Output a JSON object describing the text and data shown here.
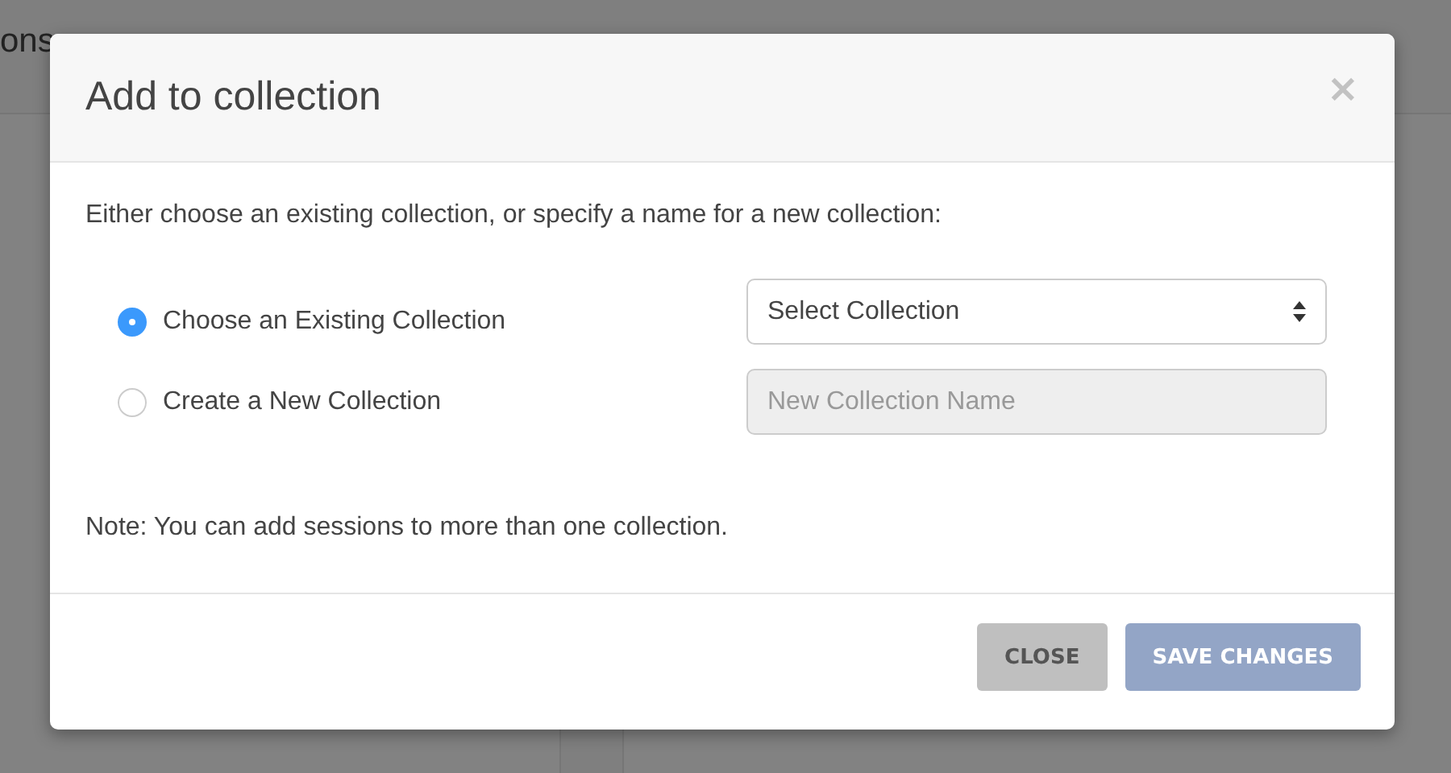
{
  "page": {
    "title_fragment": "ons"
  },
  "dialog": {
    "title": "Add to collection",
    "close_symbol": "×",
    "intro": "Either choose an existing collection, or specify a name for a new collection:",
    "options": [
      {
        "label": "Choose an Existing Collection",
        "selected": true,
        "kind": "select",
        "value": "Select Collection",
        "disabled": false
      },
      {
        "label": "Create a New Collection",
        "selected": false,
        "kind": "text",
        "placeholder": "New Collection Name",
        "disabled": true
      }
    ],
    "note": "Note: You can add sessions to more than one collection.",
    "buttons": [
      {
        "label": "CLOSE",
        "kind": "secondary"
      },
      {
        "label": "SAVE CHANGES",
        "kind": "primary"
      }
    ]
  }
}
